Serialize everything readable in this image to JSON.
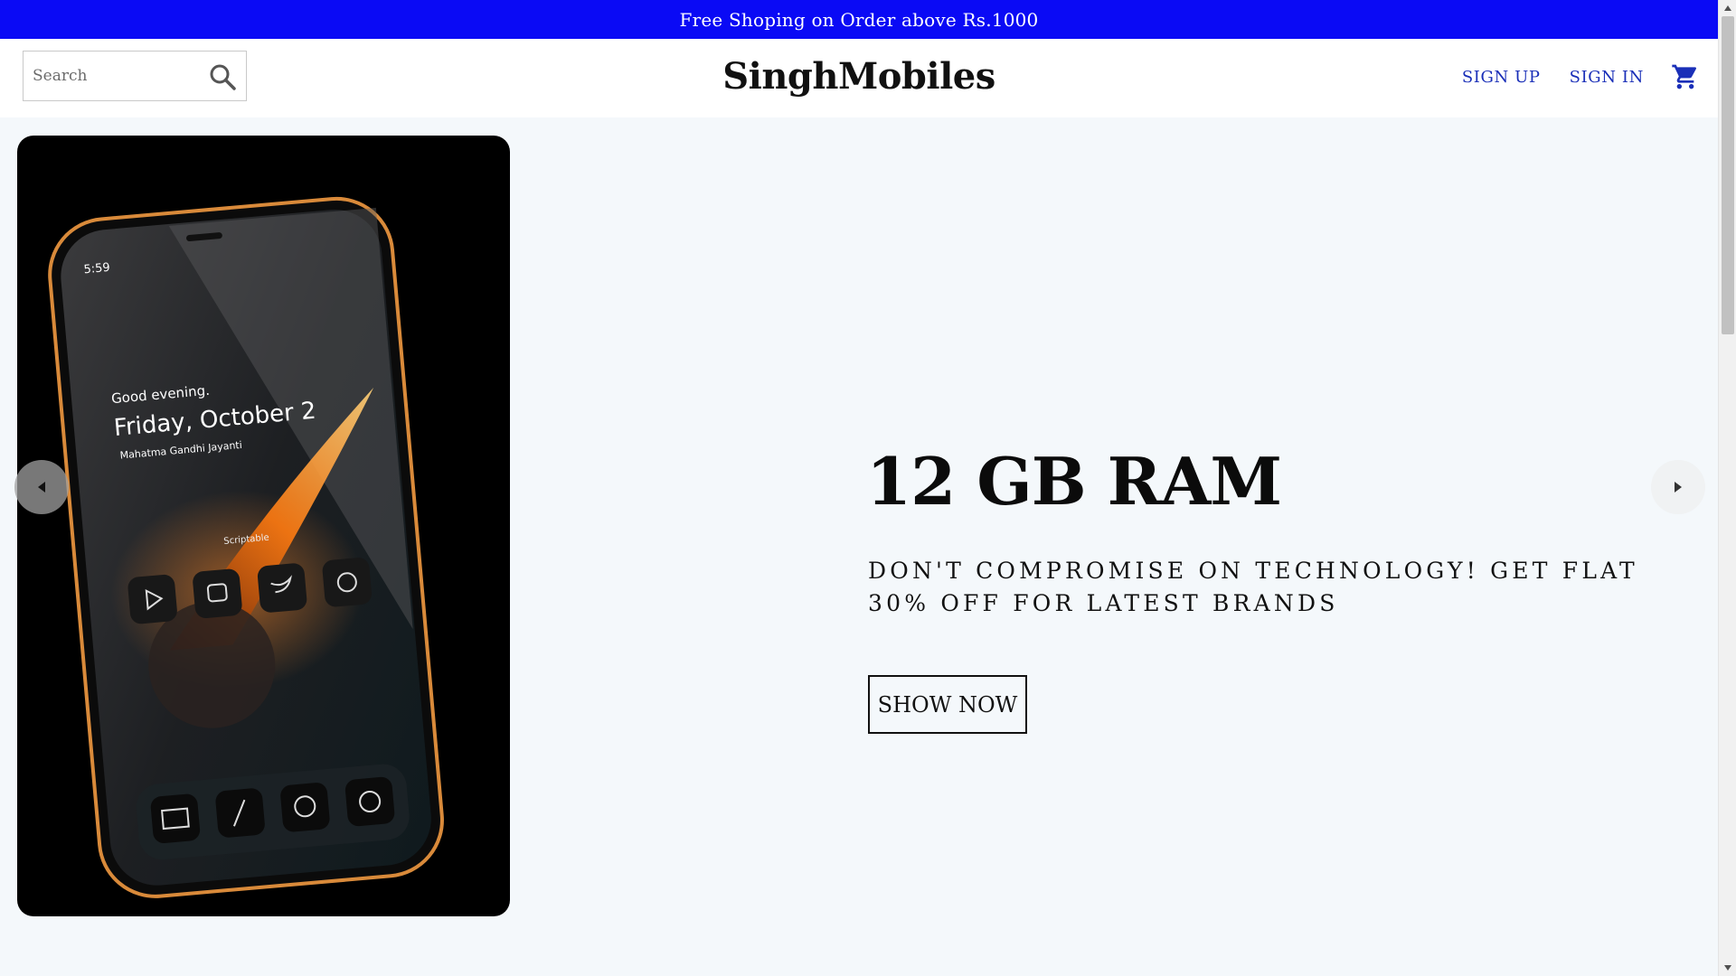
{
  "announcement": {
    "text": "Free Shoping on Order above Rs.1000"
  },
  "header": {
    "search_placeholder": "Search",
    "brand": "SinghMobiles",
    "sign_up": "SIGN UP",
    "sign_in": "SIGN IN",
    "icons": {
      "search": "search-icon",
      "cart": "shopping-cart-icon"
    }
  },
  "hero": {
    "title": "12 GB RAM",
    "subtitle": "DON'T COMPROMISE ON TECHNOLOGY! GET FLAT 30% OFF FOR LATEST BRANDS",
    "cta": "SHOW NOW",
    "phone_screen": {
      "time": "5:59",
      "greeting": "Good evening.",
      "date": "Friday, October 2",
      "event": "Mahatma Gandhi Jayanti",
      "widget_label": "Scriptable"
    }
  },
  "colors": {
    "announce_bg": "#0a0af5",
    "link": "#1a2fb8",
    "page_bg": "#f4f8fb"
  }
}
